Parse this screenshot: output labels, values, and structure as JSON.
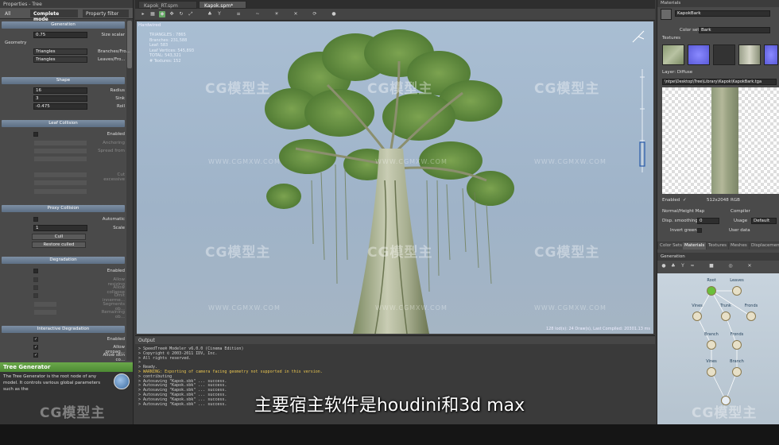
{
  "left_panel": {
    "title": "Properties - Tree",
    "tabs": [
      "All",
      "Complete mode",
      "Property filter"
    ],
    "sections": {
      "generation": "Generation",
      "shape": "Shape",
      "leaf_collision": "Leaf Collision",
      "proxy_collision": "Proxy Collision",
      "degradation": "Degradation",
      "interactive_degradation": "Interactive Degradation"
    },
    "fields": {
      "size_scalar_label": "Size scalar",
      "size_scalar_value": "0.75",
      "geometry_label": "Geometry",
      "branches_label": "Branches/Fro...",
      "branches_value": "Triangles",
      "leaves_label": "Leaves/Fro...",
      "leaves_value": "Triangles",
      "radius_label": "Radius",
      "radius_value": "16",
      "sink_label": "Sink",
      "sink_value": "3",
      "roll_label": "Roll",
      "roll_value": "-0.475",
      "lc_enabled_label": "Enabled",
      "lc_rows": [
        "Anchoring",
        "Spread from",
        "",
        "Cut excessive",
        "",
        ""
      ],
      "automatic_label": "Automatic",
      "scale_label": "Scale",
      "scale_value": "1",
      "cull_button": "Cull",
      "restore_button": "Restore culled",
      "deg_enabled_label": "Enabled",
      "deg_rows": [
        "Allow resizing",
        "Allow collapse",
        "Omit innerme...",
        "Segments ob...",
        "Remaining ob..."
      ],
      "ideg_enabled_label": "Enabled",
      "allow_propag_label": "Allow propag...",
      "allow_skin_label": "Allow skin co..."
    },
    "help": {
      "title": "Tree Generator",
      "text": "The Tree Generator is the root node of any model. It controls various global parameters such as the"
    }
  },
  "doc_tabs": [
    "Kapok_RT.spm",
    "Kapok.spm*"
  ],
  "viewport": {
    "caption": "Hardwired",
    "stats": [
      "TRIANGLES : 7865",
      "Branches: 231,588",
      "Leaf: 583",
      "Leaf Vertices: 545,893",
      "TOTAL: 543,321",
      "",
      "# Textures: 152"
    ],
    "info": "128 lod(s): 24 Draw(s), Last Compiled: 20301.13 ms"
  },
  "output": {
    "title": "Output",
    "lines": [
      {
        "t": "> SpeedTree® Modeler v6.0.0 (Cinema Edition)",
        "warn": false
      },
      {
        "t": "> Copyright © 2003-2011 IDV, Inc.",
        "warn": false
      },
      {
        "t": "> All rights reserved.",
        "warn": false
      },
      {
        "t": ">",
        "warn": false
      },
      {
        "t": "> Ready.",
        "warn": false
      },
      {
        "t": "> WARNING: Exporting of camera facing geometry not supported in this version.",
        "warn": true
      },
      {
        "t": "> contributing",
        "warn": false
      },
      {
        "t": "> Autosaving \"Kapok.sbk\" ... success.",
        "warn": false
      },
      {
        "t": "> Autosaving \"Kapok.sbk\" ... success.",
        "warn": false
      },
      {
        "t": "> Autosaving \"Kapok.sbk\" ... success.",
        "warn": false
      },
      {
        "t": "> Autosaving \"Kapok.sbk\" ... success.",
        "warn": false
      },
      {
        "t": "> Autosaving \"Kapok.sbk\" ... success.",
        "warn": false
      },
      {
        "t": "> Autosaving \"Kapok.sbk\" ... success.",
        "warn": false
      }
    ]
  },
  "right_panel": {
    "title": "Materials",
    "material_name": "KapokBark",
    "color_set_label": "Color set",
    "color_set_value": "Bark",
    "textures_label": "Textures",
    "layer_label": "Layer: Diffuse",
    "path": "\\ntpe\\Desktop\\Tree\\Library\\Kapok\\KapokBark.tga",
    "enabled_label": "Enabled",
    "enabled_check": "✓",
    "resolution": "512x2048",
    "format": "RGB",
    "normal_map_label": "Normal/Height Map",
    "compiler_label": "Compiler",
    "disp_label": "Disp. smoothing",
    "disp_value": "0",
    "usage_label": "Usage",
    "usage_value": "Default",
    "invert_label": "Invert green",
    "user_data_label": "User data",
    "tabs": [
      "Color Sets",
      "Materials",
      "Textures",
      "Meshes",
      "Displacements"
    ],
    "generation_title": "Generation",
    "graph_labels": [
      "Root",
      "Leaves",
      "Vines",
      "Trunk",
      "Fronds",
      "Branch",
      "Fronds",
      "Vines",
      "Branch"
    ]
  },
  "watermark": {
    "brand": "CG模型主",
    "url": "WWW.CGMXW.COM"
  },
  "subtitle": "主要宿主软件是houdini和3d max"
}
